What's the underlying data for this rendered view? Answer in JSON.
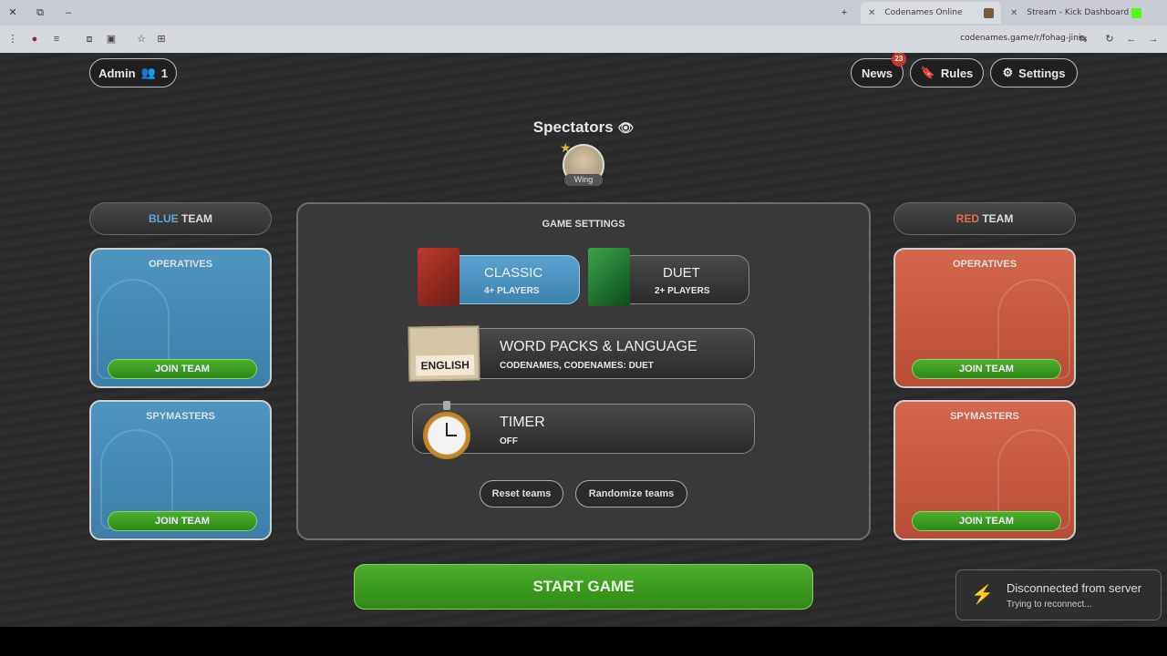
{
  "browser": {
    "tabs": [
      {
        "title": "Codenames Online",
        "active": true
      },
      {
        "title": "Stream - Kick Dashboard",
        "active": false
      }
    ],
    "url": "codenames.game/r/fohag-jinis",
    "new_tab": "+"
  },
  "header": {
    "admin_label": "Admin",
    "player_count": "1",
    "news_label": "News",
    "news_badge": "23",
    "rules_label": "Rules",
    "settings_label": "Settings"
  },
  "spectators": {
    "title": "Spectators",
    "members": [
      {
        "name": "Wing"
      }
    ]
  },
  "blue_team": {
    "name_color_word": "BLUE",
    "name_rest": "TEAM",
    "operatives_label": "OPERATIVES",
    "spymasters_label": "SPYMASTERS",
    "join_label": "JOIN TEAM",
    "color": "#3d7fa8"
  },
  "red_team": {
    "name_color_word": "RED",
    "name_rest": "TEAM",
    "operatives_label": "OPERATIVES",
    "spymasters_label": "SPYMASTERS",
    "join_label": "JOIN TEAM",
    "color": "#b84e36"
  },
  "game_settings": {
    "title": "GAME SETTINGS",
    "modes": [
      {
        "title": "CLASSIC",
        "subtitle": "4+ PLAYERS",
        "selected": true
      },
      {
        "title": "DUET",
        "subtitle": "2+ PLAYERS",
        "selected": false
      }
    ],
    "word_packs": {
      "title": "WORD PACKS & LANGUAGE",
      "subtitle": "CODENAMES, CODENAMES: DUET",
      "language_card": "ENGLISH"
    },
    "timer": {
      "title": "TIMER",
      "subtitle": "OFF"
    },
    "reset_label": "Reset teams",
    "randomize_label": "Randomize teams"
  },
  "start_label": "START GAME",
  "toast": {
    "title": "Disconnected from server",
    "subtitle": "Trying to reconnect..."
  }
}
